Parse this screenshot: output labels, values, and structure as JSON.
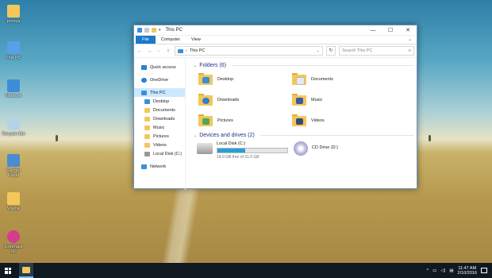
{
  "desktop": {
    "icons": [
      {
        "label": "poorya",
        "icon": "folder-icon",
        "color": "#f3c75a"
      },
      {
        "label": "This PC",
        "icon": "computer-icon",
        "color": "#5aa0e6"
      },
      {
        "label": "Network",
        "icon": "network-icon",
        "color": "#3c8ed6"
      },
      {
        "label": "Recycle Bin",
        "icon": "recycle-bin-icon",
        "color": "#b5d3e8"
      },
      {
        "label": "Control Panel",
        "icon": "control-panel-icon",
        "color": "#4b8cd0"
      },
      {
        "label": "Vrame",
        "icon": "folder-icon",
        "color": "#f3c75a"
      },
      {
        "label": "IconPack XP",
        "icon": "iconpack-icon",
        "color": "#d63c8c"
      }
    ]
  },
  "window": {
    "title": "This PC",
    "tabs": {
      "file": "File",
      "computer": "Computer",
      "view": "View"
    },
    "address": {
      "path": "This PC"
    },
    "search": {
      "placeholder": "Search This PC"
    },
    "nav": {
      "quick_access": "Quick access",
      "onedrive": "OneDrive",
      "this_pc": "This PC",
      "items": [
        "Desktop",
        "Documents",
        "Downloads",
        "Music",
        "Pictures",
        "Videos",
        "Local Disk (C:)"
      ],
      "network": "Network"
    },
    "folders_header": "Folders (6)",
    "folders": [
      {
        "label": "Desktop",
        "emblem": "#3c8ed6"
      },
      {
        "label": "Documents",
        "emblem": "#e8e8e8"
      },
      {
        "label": "Downloads",
        "emblem": "#2e7fd0"
      },
      {
        "label": "Music",
        "emblem": "#3b5ba8"
      },
      {
        "label": "Pictures",
        "emblem": "#4da85a"
      },
      {
        "label": "Videos",
        "emblem": "#344a7a"
      }
    ],
    "drives_header": "Devices and drives (2)",
    "drives": {
      "local": {
        "label": "Local Disk (C:)",
        "free": "19.0 GB free of 31.5 GB",
        "used_fraction": 0.4
      },
      "cd": {
        "label": "CD Drive (D:)"
      }
    }
  },
  "taskbar": {
    "time": "11:47 AM",
    "date": "2/10/2016",
    "accent": "#76b9ed"
  }
}
